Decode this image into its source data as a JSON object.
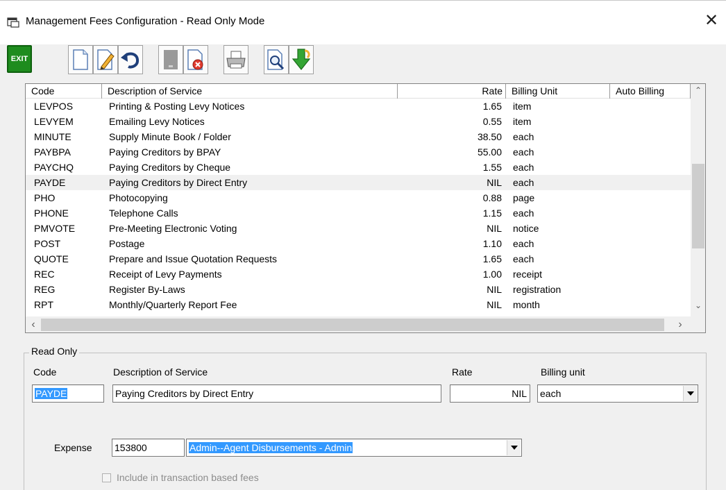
{
  "window": {
    "title": "Management Fees Configuration - Read Only Mode",
    "close_glyph": "✕"
  },
  "toolbar": {
    "exit_label": "EXIT",
    "buttons": [
      "new-document-icon",
      "edit-icon",
      "undo-icon",
      "save-icon",
      "delete-icon",
      "print-icon",
      "print-preview-icon",
      "import-icon"
    ]
  },
  "list": {
    "columns": [
      "Code",
      "Description of Service",
      "Rate",
      "Billing Unit",
      "Auto Billing"
    ],
    "rows": [
      {
        "code": "LEVPOS",
        "desc": "Printing & Posting Levy Notices",
        "rate": "1.65",
        "unit": "item"
      },
      {
        "code": "LEVYEM",
        "desc": "Emailing Levy Notices",
        "rate": "0.55",
        "unit": "item"
      },
      {
        "code": "MINUTE",
        "desc": "Supply Minute Book / Folder",
        "rate": "38.50",
        "unit": "each"
      },
      {
        "code": "PAYBPA",
        "desc": "Paying Creditors by BPAY",
        "rate": "55.00",
        "unit": "each"
      },
      {
        "code": "PAYCHQ",
        "desc": "Paying Creditors by Cheque",
        "rate": "1.55",
        "unit": "each"
      },
      {
        "code": "PAYDE",
        "desc": "Paying Creditors by Direct Entry",
        "rate": "NIL",
        "unit": "each"
      },
      {
        "code": "PHO",
        "desc": "Photocopying",
        "rate": "0.88",
        "unit": "page"
      },
      {
        "code": "PHONE",
        "desc": "Telephone Calls",
        "rate": "1.15",
        "unit": "each"
      },
      {
        "code": "PMVOTE",
        "desc": "Pre-Meeting Electronic Voting",
        "rate": "NIL",
        "unit": "notice"
      },
      {
        "code": "POST",
        "desc": "Postage",
        "rate": "1.10",
        "unit": "each"
      },
      {
        "code": "QUOTE",
        "desc": "Prepare and Issue Quotation Requests",
        "rate": "1.65",
        "unit": "each"
      },
      {
        "code": "REC",
        "desc": "Receipt of Levy Payments",
        "rate": "1.00",
        "unit": "receipt"
      },
      {
        "code": "REG",
        "desc": "Register By-Laws",
        "rate": "NIL",
        "unit": "registration"
      },
      {
        "code": "RPT",
        "desc": "Monthly/Quarterly Report Fee",
        "rate": "NIL",
        "unit": "month"
      }
    ],
    "selected_code": "PAYDE"
  },
  "form": {
    "group_title": "Read Only",
    "code_label": "Code",
    "desc_label": "Description of Service",
    "rate_label": "Rate",
    "unit_label": "Billing unit",
    "code_value": "PAYDE",
    "desc_value": "Paying Creditors by Direct Entry",
    "rate_value": "NIL",
    "unit_value": "each",
    "expense_label": "Expense",
    "expense_code": "153800",
    "expense_account": "Admin--Agent Disbursements - Admin",
    "include_label": "Include in transaction based fees",
    "include_checked": false
  }
}
